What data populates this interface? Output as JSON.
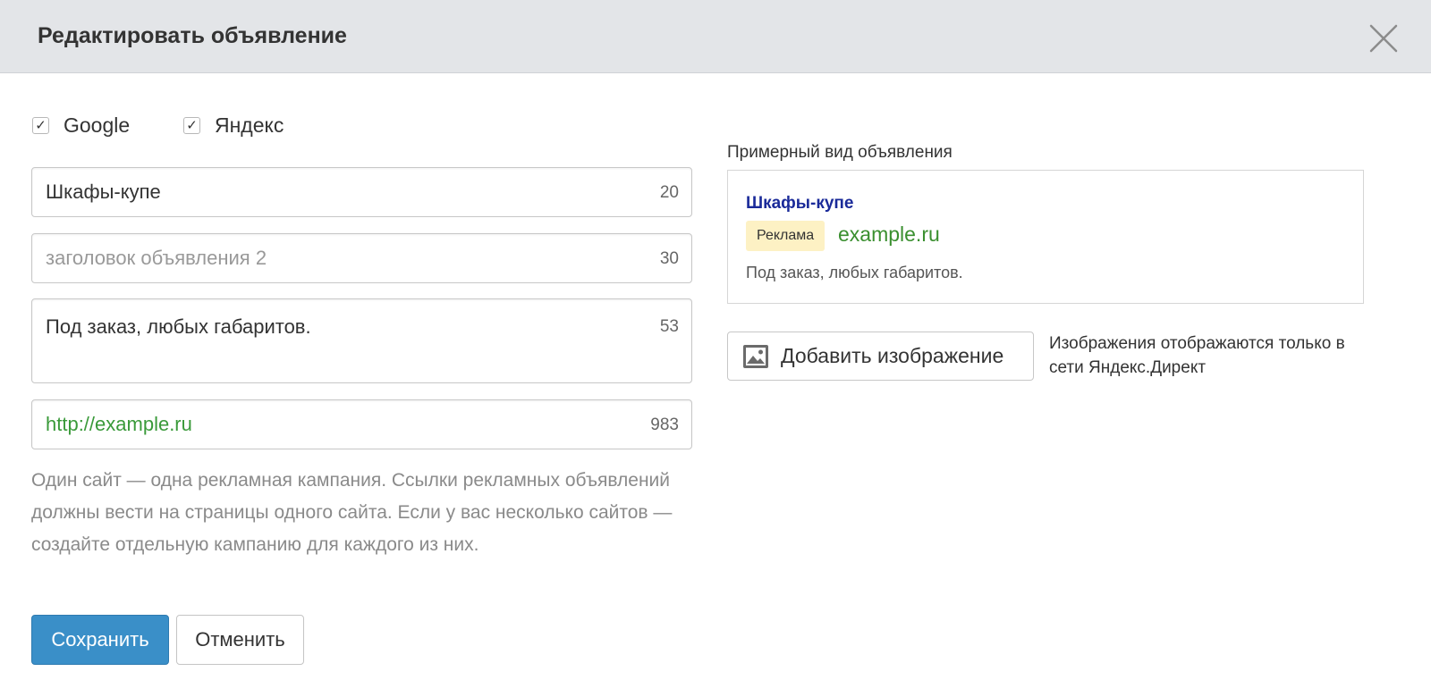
{
  "dialog": {
    "title": "Редактировать объявление",
    "close_icon": "close-icon"
  },
  "targets": [
    {
      "label": "Google",
      "checked": true
    },
    {
      "label": "Яндекс",
      "checked": true
    }
  ],
  "form": {
    "title1": {
      "value": "Шкафы-купе",
      "count": "20"
    },
    "title2": {
      "placeholder": "заголовок объявления 2",
      "count": "30"
    },
    "text": {
      "value": "Под заказ, любых габаритов.",
      "count": "53"
    },
    "url": {
      "value": "http://example.ru",
      "count": "983"
    },
    "hint": "Один сайт — одна рекламная кампания. Ссылки рекламных объявлений должны вести на страницы одного сайта. Если у вас несколько сайтов — создайте отдельную кампанию для каждого из них."
  },
  "actions": {
    "save_label": "Сохранить",
    "cancel_label": "Отменить"
  },
  "preview": {
    "label": "Примерный вид объявления",
    "title": "Шкафы-купе",
    "badge": "Реклама",
    "domain": "example.ru",
    "text": "Под заказ, любых габаритов."
  },
  "image": {
    "button_label": "Добавить изображение",
    "icon": "image-icon",
    "note": "Изображения отображаются только в сети Яндекс.Директ"
  },
  "colors": {
    "header_bg": "#e3e5e8",
    "primary_button": "#3a8fc8",
    "link_title": "#1a2a99",
    "url_green": "#3a8f2f",
    "badge_bg": "#fdf1c4"
  }
}
